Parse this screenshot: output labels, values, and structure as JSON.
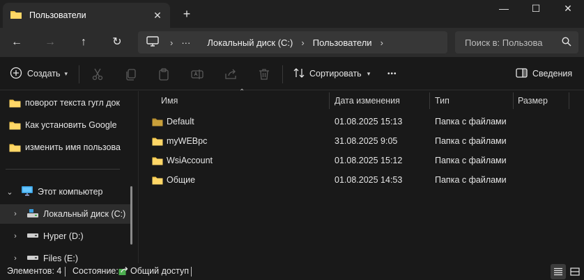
{
  "tab": {
    "title": "Пользователи",
    "icon": "folder-icon",
    "close": "✕",
    "new": "+"
  },
  "window_controls": {
    "minimize": "—",
    "maximize": "☐",
    "close": "✕"
  },
  "nav": {
    "back": "←",
    "forward": "→",
    "up": "↑",
    "refresh": "↻"
  },
  "address": {
    "breadcrumbs": [
      "Локальный диск (C:)",
      "Пользователи"
    ],
    "more": "···",
    "separator": "›"
  },
  "search": {
    "placeholder": "Поиск в: Пользова"
  },
  "toolbar": {
    "create_label": "Создать",
    "sort_label": "Сортировать",
    "more_label": "•••",
    "details_label": "Сведения"
  },
  "sidebar": {
    "quick_items": [
      {
        "label": "поворот текста гугл док"
      },
      {
        "label": "Как установить Google"
      },
      {
        "label": "изменить имя пользова"
      }
    ],
    "this_pc": {
      "label": "Этот компьютер"
    },
    "drives": [
      {
        "label": "Локальный диск (C:)",
        "selected": true
      },
      {
        "label": "Hyper (D:)"
      },
      {
        "label": "Files (E:)"
      }
    ]
  },
  "columns": {
    "name": "Имя",
    "modified": "Дата изменения",
    "type": "Тип",
    "size": "Размер"
  },
  "files": [
    {
      "name": "Default",
      "modified": "01.08.2025 15:13",
      "type": "Папка с файлами",
      "dim": true
    },
    {
      "name": "myWEBpc",
      "modified": "31.08.2025 9:05",
      "type": "Папка с файлами"
    },
    {
      "name": "WsiAccount",
      "modified": "01.08.2025 15:12",
      "type": "Папка с файлами"
    },
    {
      "name": "Общие",
      "modified": "01.08.2025 14:53",
      "type": "Папка с файлами"
    }
  ],
  "status": {
    "count": "Элементов: 4",
    "state_label": "Состояние:",
    "state_value": "Общий доступ"
  },
  "colors": {
    "accent": "#60cdff",
    "folder": "#f7c948",
    "folder_dim": "#b38a2d"
  }
}
